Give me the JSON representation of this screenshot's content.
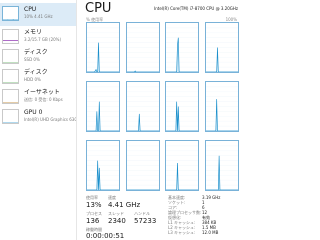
{
  "sidebar": {
    "items": [
      {
        "label": "CPU",
        "sub": "10% 4.41 GHz"
      },
      {
        "label": "メモリ",
        "sub": "3.2/15.7 GB (20%)"
      },
      {
        "label": "ディスク",
        "sub": "SSD 0%"
      },
      {
        "label": "ディスク",
        "sub": "HDD 0%"
      },
      {
        "label": "イーサネット",
        "sub": "送信: 0 受信: 0 Kbps"
      },
      {
        "label": "GPU 0",
        "sub": "Intel(R) UHD Graphics 630 0%"
      }
    ]
  },
  "main": {
    "title": "CPU",
    "model": "Intel(R) Core(TM) i7-8700 CPU @ 3.20GHz",
    "axis_top_left": "% 使用率",
    "axis_top_right": "100%"
  },
  "stats": {
    "util_label": "使用率",
    "util_value": "13%",
    "speed_label": "速度",
    "speed_value": "4.41 GHz",
    "proc_label": "プロセス",
    "proc_value": "136",
    "thread_label": "スレッド",
    "thread_value": "2340",
    "handle_label": "ハンドル",
    "handle_value": "57233",
    "uptime_label": "稼働時間",
    "uptime_value": "0:00:00:51",
    "info": [
      {
        "k": "基本速度:",
        "v": "3.19 GHz"
      },
      {
        "k": "ソケット:",
        "v": "1"
      },
      {
        "k": "コア:",
        "v": "6"
      },
      {
        "k": "論理プロセッサ数:",
        "v": "12"
      },
      {
        "k": "仮想化:",
        "v": "有効"
      },
      {
        "k": "L1 キャッシュ:",
        "v": "384 KB"
      },
      {
        "k": "L2 キャッシュ:",
        "v": "1.5 MB"
      },
      {
        "k": "L3 キャッシュ:",
        "v": "12.0 MB"
      }
    ]
  },
  "chart_data": {
    "type": "area",
    "title": "",
    "xlabel": "",
    "ylabel": "",
    "ylim": [
      0,
      100
    ],
    "series": [
      {
        "values": [
          0,
          0,
          0,
          0,
          0,
          0,
          0,
          0,
          0,
          0,
          2,
          5,
          0,
          0,
          60,
          0,
          0,
          0,
          0,
          0,
          0,
          0,
          0,
          0,
          0,
          0,
          0,
          0,
          0,
          0,
          0,
          0,
          0,
          0,
          0,
          0,
          0,
          0,
          0,
          0
        ]
      },
      {
        "values": [
          0,
          0,
          0,
          0,
          0,
          0,
          0,
          0,
          0,
          0,
          2,
          0,
          0,
          0,
          0,
          0,
          0,
          0,
          0,
          0,
          0,
          0,
          0,
          0,
          0,
          0,
          0,
          0,
          0,
          0,
          0,
          0,
          0,
          0,
          0,
          0,
          0,
          0,
          0,
          0
        ]
      },
      {
        "values": [
          0,
          0,
          0,
          0,
          0,
          0,
          0,
          0,
          0,
          0,
          0,
          0,
          0,
          0,
          55,
          70,
          0,
          0,
          0,
          0,
          0,
          0,
          0,
          0,
          0,
          0,
          0,
          0,
          0,
          0,
          0,
          0,
          0,
          0,
          0,
          0,
          0,
          0,
          0,
          0
        ]
      },
      {
        "values": [
          0,
          0,
          0,
          0,
          0,
          0,
          0,
          0,
          0,
          0,
          0,
          0,
          0,
          0,
          50,
          0,
          0,
          0,
          0,
          0,
          0,
          0,
          0,
          0,
          0,
          0,
          0,
          0,
          0,
          0,
          0,
          0,
          0,
          0,
          0,
          0,
          0,
          0,
          0,
          0
        ]
      },
      {
        "values": [
          0,
          0,
          0,
          0,
          0,
          0,
          0,
          0,
          0,
          0,
          0,
          0,
          40,
          0,
          0,
          60,
          0,
          0,
          0,
          0,
          0,
          0,
          0,
          0,
          0,
          0,
          0,
          0,
          0,
          0,
          0,
          0,
          0,
          0,
          0,
          0,
          0,
          0,
          0,
          0
        ]
      },
      {
        "values": [
          0,
          0,
          0,
          0,
          0,
          0,
          0,
          0,
          0,
          0,
          0,
          0,
          0,
          0,
          0,
          35,
          0,
          0,
          0,
          0,
          0,
          0,
          0,
          0,
          0,
          0,
          0,
          0,
          0,
          0,
          0,
          0,
          0,
          0,
          0,
          0,
          0,
          0,
          0,
          0
        ]
      },
      {
        "values": [
          0,
          0,
          0,
          0,
          0,
          0,
          0,
          0,
          0,
          0,
          0,
          0,
          0,
          60,
          0,
          50,
          0,
          0,
          0,
          0,
          0,
          0,
          0,
          0,
          0,
          0,
          0,
          0,
          0,
          0,
          0,
          0,
          0,
          0,
          0,
          0,
          0,
          0,
          0,
          0
        ]
      },
      {
        "values": [
          0,
          0,
          0,
          0,
          0,
          0,
          0,
          0,
          0,
          0,
          0,
          0,
          0,
          65,
          0,
          0,
          0,
          0,
          0,
          0,
          0,
          0,
          0,
          0,
          0,
          0,
          0,
          0,
          0,
          0,
          0,
          0,
          0,
          0,
          0,
          0,
          0,
          0,
          0,
          0
        ]
      },
      {
        "values": [
          0,
          0,
          0,
          0,
          0,
          0,
          0,
          0,
          0,
          0,
          0,
          0,
          0,
          60,
          0,
          45,
          0,
          0,
          0,
          0,
          0,
          0,
          0,
          0,
          0,
          0,
          0,
          0,
          0,
          0,
          0,
          0,
          0,
          0,
          0,
          0,
          0,
          0,
          0,
          0
        ]
      },
      {
        "values": [
          0,
          0,
          0,
          0,
          0,
          0,
          0,
          0,
          0,
          0,
          0,
          0,
          0,
          0,
          0,
          0,
          0,
          0,
          0,
          0,
          0,
          0,
          0,
          0,
          0,
          0,
          0,
          0,
          0,
          0,
          0,
          0,
          0,
          0,
          0,
          0,
          0,
          0,
          0,
          0
        ]
      },
      {
        "values": [
          0,
          0,
          0,
          0,
          0,
          0,
          0,
          0,
          0,
          0,
          0,
          0,
          0,
          0,
          55,
          0,
          0,
          0,
          0,
          0,
          0,
          0,
          0,
          0,
          0,
          0,
          0,
          0,
          0,
          0,
          0,
          0,
          0,
          0,
          0,
          0,
          0,
          0,
          0,
          0
        ]
      },
      {
        "values": [
          0,
          0,
          0,
          0,
          0,
          0,
          0,
          0,
          0,
          0,
          0,
          0,
          0,
          0,
          0,
          0,
          70,
          0,
          0,
          0,
          0,
          0,
          0,
          0,
          0,
          0,
          0,
          0,
          0,
          0,
          0,
          0,
          0,
          0,
          0,
          0,
          0,
          0,
          0,
          0
        ]
      }
    ]
  },
  "sidebar_thumbs": {
    "cpu": [
      0,
      0,
      0,
      0,
      0,
      0,
      1,
      0,
      0,
      0,
      0,
      0,
      0,
      2,
      0,
      0,
      0,
      0,
      0,
      0
    ],
    "mem": [
      20,
      20,
      20,
      20,
      20,
      20,
      20,
      20,
      20,
      20,
      20,
      20,
      20,
      20,
      20,
      20,
      20,
      20,
      20,
      20
    ],
    "disk1": [
      0,
      0,
      0,
      0,
      0,
      0,
      0,
      0,
      0,
      0,
      0,
      0,
      0,
      0,
      0,
      0,
      0,
      0,
      0,
      0
    ],
    "disk2": [
      0,
      0,
      0,
      0,
      0,
      0,
      0,
      0,
      0,
      0,
      0,
      0,
      0,
      0,
      0,
      0,
      0,
      0,
      0,
      0
    ],
    "eth": [
      0,
      0,
      0,
      0,
      0,
      0,
      0,
      0,
      0,
      0,
      0,
      0,
      0,
      0,
      0,
      0,
      0,
      0,
      0,
      0
    ],
    "gpu": [
      0,
      0,
      0,
      0,
      0,
      0,
      0,
      0,
      0,
      0,
      0,
      0,
      0,
      0,
      0,
      0,
      0,
      0,
      0,
      0
    ]
  },
  "colors": {
    "cpu_line": "#1a8fcb",
    "cpu_fill": "#d7ecf8",
    "mem_line": "#8b2bb0",
    "disk_line": "#4ca64c",
    "eth_line": "#b36b00",
    "gpu_line": "#1a8fcb",
    "sidebar_active": "#dcebf7"
  }
}
